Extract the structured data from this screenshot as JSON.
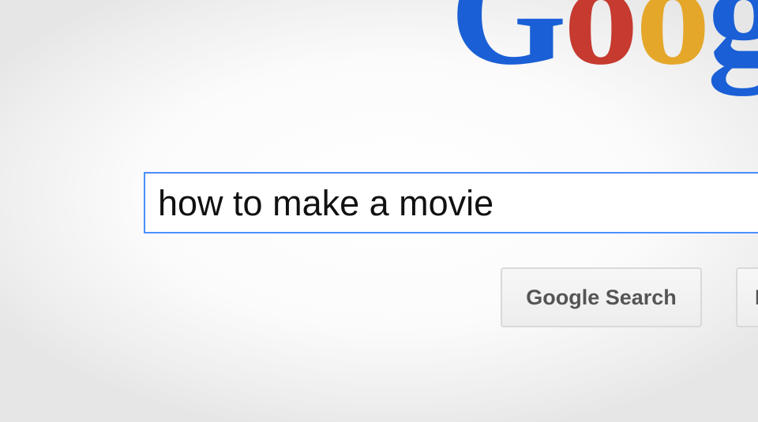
{
  "logo": {
    "letters": [
      "G",
      "o",
      "o",
      "g"
    ],
    "colors": [
      "#1a5fd6",
      "#c63a2f",
      "#e4a72a",
      "#1a5fd6"
    ]
  },
  "search": {
    "query": "how to make a movie"
  },
  "buttons": {
    "search_label": "Google Search",
    "lucky_label": "I"
  }
}
